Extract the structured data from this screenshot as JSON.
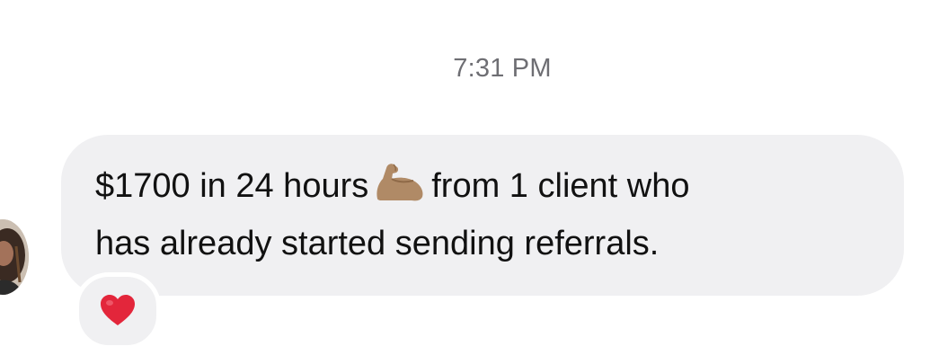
{
  "timestamp": "7:31 PM",
  "message": {
    "line1_before_emoji": "$1700 in 24 hours",
    "emoji": "flexed-biceps-icon",
    "line1_after_emoji": "from 1 client who",
    "line2": "has already started sending referrals."
  },
  "reaction": {
    "emoji": "red-heart-icon"
  },
  "colors": {
    "bubble_background": "#f0f0f2",
    "timestamp_text": "#6e6e73",
    "message_text": "#111111",
    "heart": "#e3263b"
  }
}
